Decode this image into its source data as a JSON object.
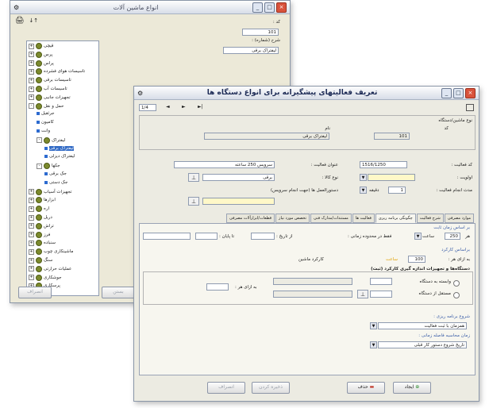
{
  "back_window": {
    "title": "انواع ماشین آلات",
    "toolbar_icon": "🖨",
    "field1_label": "کد :",
    "field1_value": "",
    "field2_label": "",
    "field2_value": "101",
    "field3_label": "شرح (شماره) :",
    "field4_value": "لیفتراک برقی",
    "tree": [
      {
        "label": "قیچی",
        "depth": 0,
        "icon": "gear",
        "expander": "+"
      },
      {
        "label": "پرس",
        "depth": 0,
        "icon": "gear",
        "expander": "+"
      },
      {
        "label": "پراس",
        "depth": 0,
        "icon": "gear",
        "expander": "+"
      },
      {
        "label": "تاسیسات هوای فشرده",
        "depth": 0,
        "icon": "gear",
        "expander": "+"
      },
      {
        "label": "تاسیسات برقی",
        "depth": 0,
        "icon": "gear",
        "expander": "+"
      },
      {
        "label": "تاسیسات آب",
        "depth": 0,
        "icon": "gear",
        "expander": "+"
      },
      {
        "label": "تجهیزات جانبی",
        "depth": 0,
        "icon": "gear",
        "expander": "+"
      },
      {
        "label": "حمل و نقل",
        "depth": 0,
        "icon": "gear",
        "expander": "-"
      },
      {
        "label": "جرثقیل",
        "depth": 1,
        "icon": "leaf",
        "expander": ""
      },
      {
        "label": "کامیون",
        "depth": 1,
        "icon": "leaf",
        "expander": ""
      },
      {
        "label": "وانت",
        "depth": 1,
        "icon": "leaf",
        "expander": ""
      },
      {
        "label": "لیفتراک",
        "depth": 1,
        "icon": "gear",
        "expander": "-"
      },
      {
        "label": "لیفتراک برقی",
        "depth": 2,
        "icon": "leaf",
        "expander": "",
        "selected": true
      },
      {
        "label": "لیفتراک دیزلی",
        "depth": 2,
        "icon": "leaf",
        "expander": ""
      },
      {
        "label": "جکها",
        "depth": 1,
        "icon": "gear",
        "expander": "-"
      },
      {
        "label": "جک برقی",
        "depth": 2,
        "icon": "leaf",
        "expander": ""
      },
      {
        "label": "جک دستی",
        "depth": 2,
        "icon": "leaf",
        "expander": ""
      },
      {
        "label": "تجهیزات آسیاب",
        "depth": 0,
        "icon": "gear",
        "expander": "+"
      },
      {
        "label": "ابزارها",
        "depth": 0,
        "icon": "gear",
        "expander": "+"
      },
      {
        "label": "اره",
        "depth": 0,
        "icon": "gear",
        "expander": "+"
      },
      {
        "label": "دریل",
        "depth": 0,
        "icon": "gear",
        "expander": "+"
      },
      {
        "label": "تراش",
        "depth": 0,
        "icon": "gear",
        "expander": "+"
      },
      {
        "label": "فرز",
        "depth": 0,
        "icon": "gear",
        "expander": "+"
      },
      {
        "label": "سنباده",
        "depth": 0,
        "icon": "gear",
        "expander": "+"
      },
      {
        "label": "ماشینکاری چوب",
        "depth": 0,
        "icon": "gear",
        "expander": "+"
      },
      {
        "label": "سنگ",
        "depth": 0,
        "icon": "gear",
        "expander": "+"
      },
      {
        "label": "عملیات حرارتی",
        "depth": 0,
        "icon": "gear",
        "expander": "+"
      },
      {
        "label": "جوشکاری",
        "depth": 0,
        "icon": "gear",
        "expander": "+"
      },
      {
        "label": "پرسکاری",
        "depth": 0,
        "icon": "gear",
        "expander": "+"
      }
    ],
    "bottom_buttons": [
      "بستن",
      "انصراف"
    ]
  },
  "front_window": {
    "title": "تعریف فعالیتهای پیشگیرانه برای انواع دستگاه ها",
    "nav": {
      "count": "1/4",
      "buttons": [
        "◄",
        "►",
        "►|"
      ]
    },
    "group_device": {
      "caption": "نوع ماشین/دستگاه",
      "code_label": "کد",
      "code_value": "101",
      "name_label": "نام",
      "name_value": "لیفتراک برقی"
    },
    "activity_code_label": "کد فعالیت :",
    "activity_code_value": "1516/1250",
    "activity_title_label": "عنوان فعالیت :",
    "activity_title_value": "سرویس 250 ساعته",
    "priority_label": "اولویت :",
    "priority_value": "",
    "part_type_label": "نوع کالا :",
    "part_type_value": "برقی",
    "duration_label": "مدت انجام فعالیت :",
    "duration_value": "1",
    "duration_unit": "دقیقه",
    "attach_label": "دستورالعمل ها (جهت انجام سرویس)",
    "tabs": [
      "موارد مصرفی",
      "شرح فعالیت",
      "چگونگی برنامه ریزی",
      "فعالیت ها",
      "مستندات/مدارک فنی",
      "تخصص مورد نیاز",
      "قطعات/ابزارآلات مصرفی"
    ],
    "interval_caption": "بر اساس زمان ثابت",
    "interval_every_label": "هر",
    "interval_every_value": "250",
    "interval_unit": "ساعت",
    "interval_check_label": "فقط در محدوده زمانی :",
    "interval_from_label": "از تاریخ :",
    "interval_to_label": "تا پایان :",
    "counter_caption": "براساس کارکرد",
    "counter_every_label": "به ازای هر :",
    "counter_value": "100",
    "counter_unit": "ساعت",
    "counter_meter_label": "کارکرد ماشین",
    "counter_device_label": "دستگاه‌ها و تجهیزات اندازه گیری کارکرد (ثبت)",
    "radio1_label": "وابسته به دستگاه",
    "radio2_label": "مستقل از دستگاه",
    "per_label": "به ازای هر :",
    "schedule_label": "شروع برنامه ریزی :",
    "schedule_value": "همزمان با ثبت فعالیت",
    "plan_label": "زمان محاسبه فاصله زمانی :",
    "plan_value": "تاریخ شروع دستور کار قبلی",
    "buttons": {
      "new": "ایجاد",
      "delete": "حذف",
      "save": "ذخیره کردن",
      "cancel": "انصراف"
    }
  }
}
